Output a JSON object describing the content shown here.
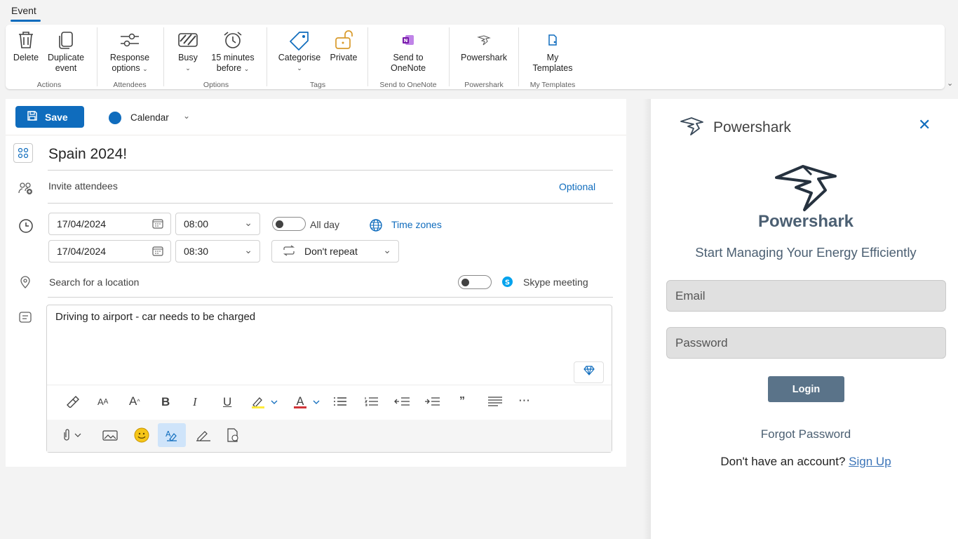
{
  "tabs": {
    "active": "Event"
  },
  "ribbon": {
    "delete": "Delete",
    "duplicate": [
      "Duplicate",
      "event"
    ],
    "response": [
      "Response",
      "options"
    ],
    "busy": "Busy",
    "reminder": [
      "15 minutes",
      "before"
    ],
    "categorise": "Categorise",
    "private": "Private",
    "onenote": [
      "Send to",
      "OneNote"
    ],
    "powershark": "Powershark",
    "templates": [
      "My",
      "Templates"
    ],
    "groups": {
      "actions": "Actions",
      "attendees": "Attendees",
      "options": "Options",
      "tags": "Tags",
      "onenote": "Send to OneNote",
      "powershark": "Powershark",
      "templates": "My Templates"
    }
  },
  "form": {
    "save": "Save",
    "calendar": "Calendar",
    "title": "Spain 2024!",
    "attendees_placeholder": "Invite attendees",
    "optional": "Optional",
    "start_date": "17/04/2024",
    "start_time": "08:00",
    "end_date": "17/04/2024",
    "end_time": "08:30",
    "all_day": "All day",
    "time_zones": "Time zones",
    "repeat": "Don't repeat",
    "location_placeholder": "Search for a location",
    "skype": "Skype meeting",
    "body": "Driving to airport - car needs to be charged"
  },
  "colors": {
    "accent": "#0f6cbd",
    "powershark_brand": "#4b5f72",
    "login_button": "#5a7389"
  },
  "pane": {
    "header": "Powershark",
    "brand": "Powershark",
    "tagline": "Start Managing Your Energy Efficiently",
    "email_placeholder": "Email",
    "password_placeholder": "Password",
    "login": "Login",
    "forgot": "Forgot Password",
    "no_account": "Don't have an account?",
    "signup": "Sign Up"
  }
}
